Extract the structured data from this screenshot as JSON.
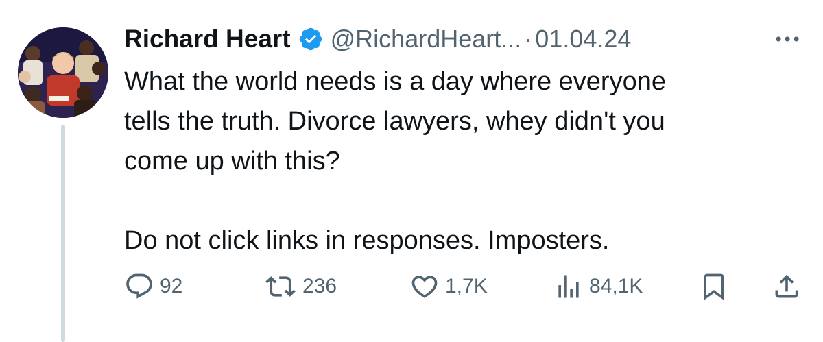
{
  "tweet": {
    "author_name": "Richard Heart",
    "handle": "@RichardHeart...",
    "separator": "·",
    "date": "01.04.24",
    "body_lines": [
      "What the world needs is a day where everyone",
      "tells the truth. Divorce lawyers, whey didn't you",
      "come up with this?"
    ],
    "body_second_paragraph": "Do not click links in responses. Imposters.",
    "verified": true
  },
  "actions": {
    "replies": "92",
    "reposts": "236",
    "likes": "1,7K",
    "views": "84,1K"
  },
  "icons": {
    "verified": "verified-badge-icon",
    "more": "more-icon",
    "reply": "reply-icon",
    "repost": "repost-icon",
    "like": "heart-icon",
    "views": "views-icon",
    "bookmark": "bookmark-icon",
    "share": "share-icon"
  },
  "colors": {
    "verified_blue": "#1d9bf0",
    "secondary_text": "#536471",
    "primary_text": "#0f1419",
    "thread_line": "#cfd9de"
  }
}
